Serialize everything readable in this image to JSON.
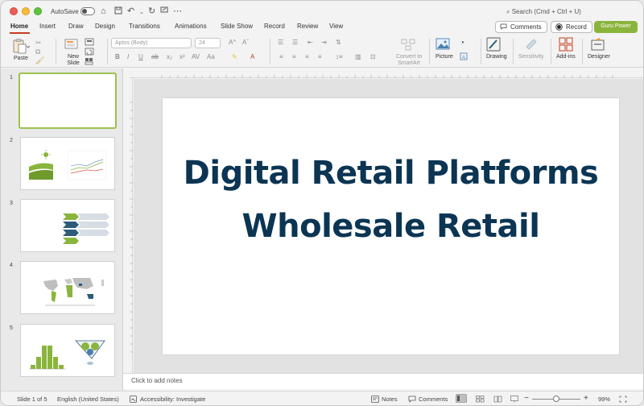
{
  "titlebar": {
    "autosave_label": "AutoSave",
    "search_placeholder": "Search (Cmd + Ctrl + U)"
  },
  "tabs": [
    "Home",
    "Insert",
    "Draw",
    "Design",
    "Transitions",
    "Animations",
    "Slide Show",
    "Record",
    "Review",
    "View"
  ],
  "actions": {
    "comments_label": "Comments",
    "record_label": "Record",
    "guru_label": "Guru Power"
  },
  "ribbon": {
    "paste_label": "Paste",
    "new_slide_label": "New Slide",
    "font_name_placeholder": "Aptos (Body)",
    "font_size_placeholder": "24",
    "convert_label": "Convert to SmartArt",
    "picture_label": "Picture",
    "drawing_label": "Drawing",
    "sensitivity_label": "Sensitivity",
    "addins_label": "Add-ins",
    "designer_label": "Designer"
  },
  "slides": {
    "numbers": [
      "1",
      "2",
      "3",
      "4",
      "5"
    ],
    "current_title": "Digital Retail Platforms Wholesale Retail"
  },
  "notes_placeholder": "Click to add notes",
  "status": {
    "slide_count": "Slide 1 of 5",
    "language": "English (United States)",
    "accessibility": "Accessibility: Investigate",
    "notes": "Notes",
    "comments": "Comments",
    "zoom": "99%"
  },
  "colors": {
    "accent_red": "#c43e1c",
    "guru_green": "#8ab53d",
    "title_navy": "#0b3553",
    "thumb_green": "#9dc04e",
    "thumb_blue": "#2d5c7a"
  }
}
